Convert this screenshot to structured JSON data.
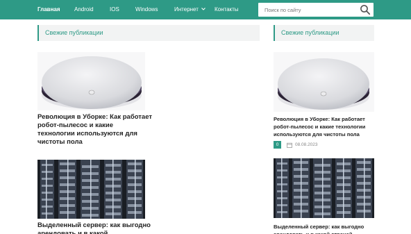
{
  "nav": {
    "items": [
      {
        "label": "Главная",
        "active": true
      },
      {
        "label": "Android"
      },
      {
        "label": "IOS"
      },
      {
        "label": "Windows"
      },
      {
        "label": "Интернет",
        "has_dropdown": true
      },
      {
        "label": "Контакты"
      }
    ],
    "search_placeholder": "Поиск по сайту",
    "search_icon": "search-icon"
  },
  "main": {
    "section_title": "Свежие публикации",
    "posts": [
      {
        "title": "Революция в Уборке: Как работает робот-пылесос и какие технологии используются для чистоты пола",
        "image": "robot-vacuum"
      },
      {
        "title": "Выделенный сервер: как выгодно арендовать и в какой",
        "image": "server-rack"
      }
    ]
  },
  "sidebar": {
    "section_title": "Свежие публикации",
    "posts": [
      {
        "title": "Революция в Уборке: Как работает робот-пылесос и какие технологии используются для чистоты пола",
        "image": "robot-vacuum",
        "comments": "0",
        "date": "08.08.2023"
      },
      {
        "title": "Выделенный сервер: как выгодно арендовать и в какой стране?",
        "image": "server-rack"
      }
    ]
  },
  "colors": {
    "accent": "#2e9a86",
    "header_bg": "#f2f3f3"
  }
}
